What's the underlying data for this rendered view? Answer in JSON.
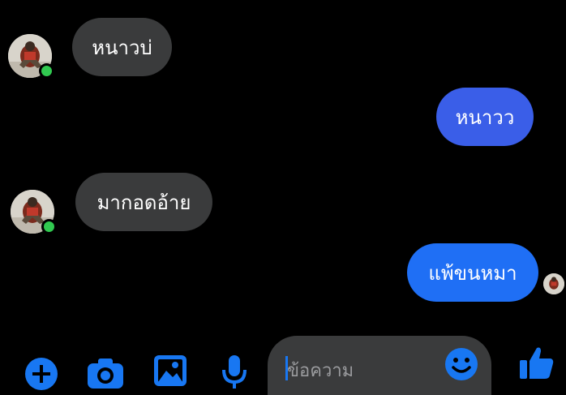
{
  "messages": [
    {
      "direction": "incoming",
      "text": "หนาวบ่"
    },
    {
      "direction": "outgoing",
      "text": "หนาวว"
    },
    {
      "direction": "incoming",
      "text": "มากอดอ้าย"
    },
    {
      "direction": "outgoing",
      "text": "แพ้ขนหมา"
    }
  ],
  "colors": {
    "background": "#000000",
    "incoming_bubble": "#3a3b3c",
    "outgoing_bubble_1": "#3a5ee8",
    "outgoing_bubble_2": "#1f6ff5",
    "accent": "#1877f2",
    "online": "#31c950"
  },
  "composer": {
    "placeholder": "ข้อความ"
  },
  "toolbar": {
    "icons": [
      "add-icon",
      "camera-icon",
      "image-icon",
      "microphone-icon",
      "emoji-icon",
      "like-icon"
    ]
  }
}
